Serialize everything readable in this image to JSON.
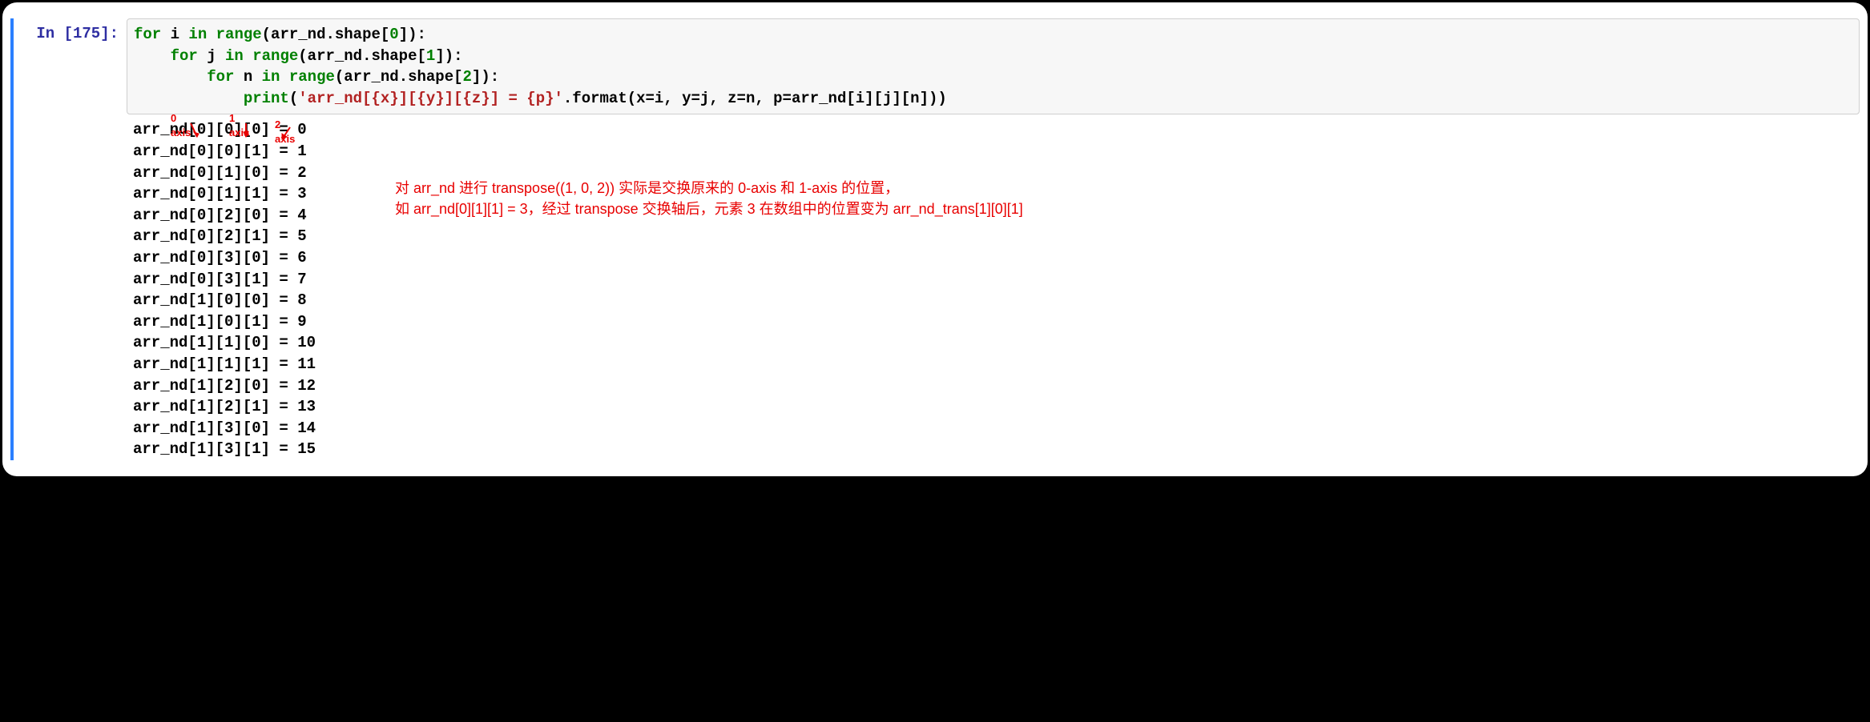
{
  "prompt": "In [175]:",
  "code": {
    "lines": [
      {
        "indent": 0,
        "parts": [
          {
            "t": "for ",
            "c": "kw"
          },
          {
            "t": "i ",
            "c": "ident"
          },
          {
            "t": "in ",
            "c": "kw"
          },
          {
            "t": "range",
            "c": "fn"
          },
          {
            "t": "(arr_nd.shape[",
            "c": "ident"
          },
          {
            "t": "0",
            "c": "num"
          },
          {
            "t": "]):",
            "c": "ident"
          }
        ]
      },
      {
        "indent": 1,
        "parts": [
          {
            "t": "for ",
            "c": "kw"
          },
          {
            "t": "j ",
            "c": "ident"
          },
          {
            "t": "in ",
            "c": "kw"
          },
          {
            "t": "range",
            "c": "fn"
          },
          {
            "t": "(arr_nd.shape[",
            "c": "ident"
          },
          {
            "t": "1",
            "c": "num"
          },
          {
            "t": "]):",
            "c": "ident"
          }
        ]
      },
      {
        "indent": 2,
        "parts": [
          {
            "t": "for ",
            "c": "kw"
          },
          {
            "t": "n ",
            "c": "ident"
          },
          {
            "t": "in ",
            "c": "kw"
          },
          {
            "t": "range",
            "c": "fn"
          },
          {
            "t": "(arr_nd.shape[",
            "c": "ident"
          },
          {
            "t": "2",
            "c": "num"
          },
          {
            "t": "]):",
            "c": "ident"
          }
        ]
      },
      {
        "indent": 3,
        "parts": [
          {
            "t": "print",
            "c": "fn"
          },
          {
            "t": "(",
            "c": "ident"
          },
          {
            "t": "'arr_nd[{x}][{y}][{z}] = {p}'",
            "c": "str"
          },
          {
            "t": ".format(x=i, y=j, z=n, p=arr_nd[i][j][n]))",
            "c": "ident"
          }
        ]
      }
    ]
  },
  "output_lines": [
    "arr_nd[0][0][0] = 0",
    "arr_nd[0][0][1] = 1",
    "arr_nd[0][1][0] = 2",
    "arr_nd[0][1][1] = 3",
    "arr_nd[0][2][0] = 4",
    "arr_nd[0][2][1] = 5",
    "arr_nd[0][3][0] = 6",
    "arr_nd[0][3][1] = 7",
    "arr_nd[1][0][0] = 8",
    "arr_nd[1][0][1] = 9",
    "arr_nd[1][1][0] = 10",
    "arr_nd[1][1][1] = 11",
    "arr_nd[1][2][0] = 12",
    "arr_nd[1][2][1] = 13",
    "arr_nd[1][3][0] = 14",
    "arr_nd[1][3][1] = 15"
  ],
  "annotations": {
    "axis0": "0 axis",
    "axis1": "1 axis",
    "axis2": "2 axis",
    "note_line1": "对 arr_nd 进行 transpose((1, 0, 2)) 实际是交换原来的 0-axis 和 1-axis 的位置，",
    "note_line2": "如 arr_nd[0][1][1] = 3，经过 transpose 交换轴后，元素 3 在数组中的位置变为 arr_nd_trans[1][0][1]"
  }
}
